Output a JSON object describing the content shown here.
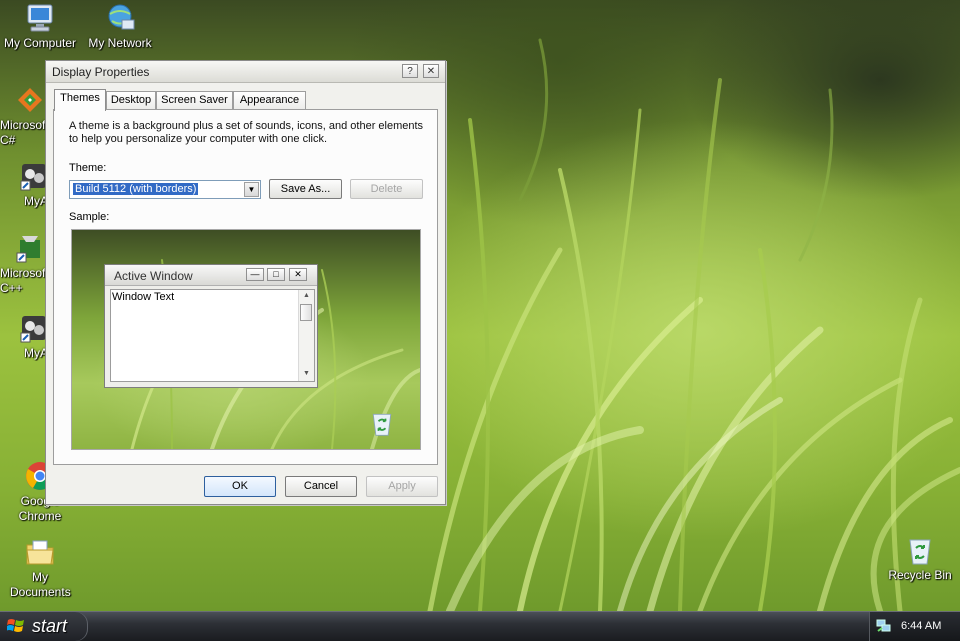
{
  "desktop": {
    "icons": [
      {
        "label": "My Computer",
        "icon": "computer-icon"
      },
      {
        "label": "My Network Places",
        "icon": "network-icon"
      },
      {
        "label": "Microsoft Visual C#",
        "icon": "visual-studio-icon"
      },
      {
        "label": "MyApp",
        "icon": "shortcut-app-icon"
      },
      {
        "label": "Microsoft Visual C++",
        "icon": "visual-studio-icon"
      },
      {
        "label": "MyApp",
        "icon": "shortcut-app-icon"
      },
      {
        "label": "Google Chrome",
        "icon": "chrome-icon"
      },
      {
        "label": "My Documents",
        "icon": "documents-folder-icon"
      },
      {
        "label": "Recycle Bin",
        "icon": "recycle-bin-icon"
      }
    ]
  },
  "dialog": {
    "title": "Display Properties",
    "help_glyph": "?",
    "close_glyph": "✕",
    "tabs": [
      {
        "label": "Themes",
        "active": true
      },
      {
        "label": "Desktop",
        "active": false
      },
      {
        "label": "Screen Saver",
        "active": false
      },
      {
        "label": "Appearance",
        "active": false
      }
    ],
    "description": "A theme is a background plus a set of sounds, icons, and other elements to help you personalize your computer with one click.",
    "theme_label": "Theme:",
    "theme_value": "Build 5112 (with borders)",
    "save_as_label": "Save As...",
    "delete_label": "Delete",
    "sample_label": "Sample:",
    "sample_window": {
      "title": "Active Window",
      "minimize_glyph": "—",
      "maximize_glyph": "□",
      "close_glyph": "✕",
      "text": "Window Text"
    },
    "ok_label": "OK",
    "cancel_label": "Cancel",
    "apply_label": "Apply"
  },
  "taskbar": {
    "start_label": "start",
    "clock": "6:44 AM"
  },
  "colors": {
    "selection": "#316ac5",
    "wallpaper_green": "#9cc23f",
    "taskbar_dark": "#1a1c20"
  }
}
